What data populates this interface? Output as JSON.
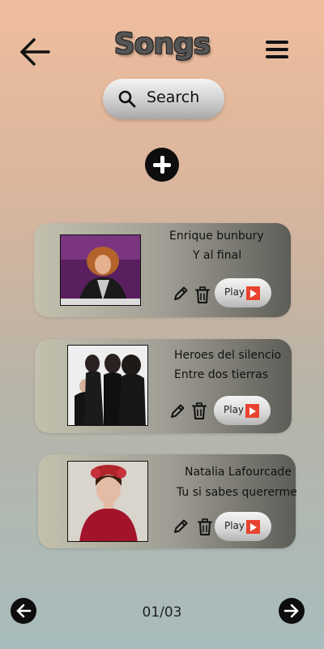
{
  "header": {
    "title": "Songs",
    "back_icon": "arrow-left-icon",
    "menu_icon": "hamburger-menu-icon"
  },
  "search": {
    "label": "Search",
    "icon": "search-icon"
  },
  "add": {
    "icon": "plus-icon"
  },
  "songs": [
    {
      "artist": "Enrique bunbury",
      "title": "Y al final",
      "play_label": "Play"
    },
    {
      "artist": "Heroes del silencio",
      "title": "Entre dos tierras",
      "play_label": "Play"
    },
    {
      "artist": "Natalia Lafourcade",
      "title": "Tu si sabes quererme",
      "play_label": "Play"
    }
  ],
  "pagination": {
    "label": "01/03"
  },
  "colors": {
    "play_badge": "#e8432f",
    "accent_dark": "#0d0d0d"
  }
}
